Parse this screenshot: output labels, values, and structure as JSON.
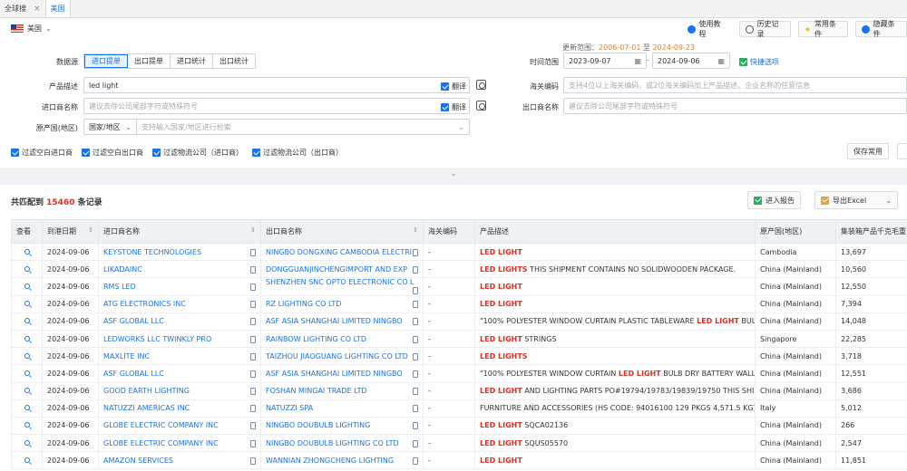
{
  "tabs": [
    {
      "label": "全球搜",
      "active": false
    },
    {
      "label": "美国",
      "active": true
    }
  ],
  "country": {
    "name": "美国"
  },
  "update_range": {
    "prefix": "更新范围：",
    "start": "2006-07-01",
    "to": "至",
    "end": "2024-09-23"
  },
  "top_buttons": {
    "tutorial": "使用教程",
    "history": "历史记录",
    "common": "常用条件",
    "hide": "隐藏条件"
  },
  "form": {
    "source_label": "数据源",
    "source_options": [
      "进口提单",
      "出口提单",
      "进口统计",
      "出口统计"
    ],
    "date_label": "时间范围",
    "date_start": "2023-09-07",
    "date_sep": "–",
    "date_end": "2024-09-06",
    "quick_label": "快捷选项",
    "product_label": "产品描述",
    "product_value": "led light",
    "translate_label": "翻译",
    "hs_label": "海关编码",
    "hs_placeholder": "支持4位以上海关编码，或2位海关编码加上产品描述、企业名称的任意信息",
    "importer_label": "进口商名称",
    "importer_placeholder": "建议去除公司尾部字符或特殊符号",
    "exporter_label": "出口商名称",
    "exporter_placeholder": "建议去除公司尾部字符或特殊符号",
    "origin_label": "原产国(地区)",
    "origin_select": "国家/地区",
    "origin_placeholder": "支持输入国家/地区进行检索",
    "filters": [
      "过滤空白进口商",
      "过滤空白出口商",
      "过滤物流公司（进口商）",
      "过滤物流公司（出口商）"
    ],
    "save_common": "保存常用"
  },
  "results": {
    "prefix": "共匹配到",
    "count": "15460",
    "suffix": "条记录",
    "report_btn": "进入报告",
    "export_btn": "导出Excel"
  },
  "table": {
    "headers": [
      "查看",
      "到港日期",
      "进口商名称",
      "出口商名称",
      "海关编码",
      "产品描述",
      "原产国(地区)",
      "集装箱产品千克毛重"
    ],
    "rows": [
      {
        "date": "2024-09-06",
        "importer": "KEYSTONE TECHNOLOGIES",
        "exporter": "NINGBO DONGXING CAMBODIA ELECTRI",
        "hs": "-",
        "hl": "LED LIGHT",
        "rest": "",
        "origin": "Cambodia",
        "weight": "13,697"
      },
      {
        "date": "2024-09-06",
        "importer": "LIKADAINC",
        "exporter": "DONGGUANJINCHENGIMPORT AND EXP",
        "hs": "-",
        "hl": "LED LIGHTS",
        "rest": " THIS SHIPMENT CONTAINS NO SOLIDWOODEN PACKAGE.",
        "origin": "China (Mainland)",
        "weight": "10,560"
      },
      {
        "date": "2024-09-06",
        "importer": "RMS LED",
        "exporter": "SHENZHEN SNC OPTO ELECTRONIC CO L",
        "hs": "-",
        "hl": "LED LIGHT",
        "rest": "",
        "origin": "China (Mainland)",
        "weight": "12,550"
      },
      {
        "date": "2024-09-06",
        "importer": "ATG ELECTRONICS INC",
        "exporter": "RZ LIGHTING CO LTD",
        "hs": "-",
        "hl": "LED LIGHT",
        "rest": "",
        "origin": "China (Mainland)",
        "weight": "7,394"
      },
      {
        "date": "2024-09-06",
        "importer": "ASF GLOBAL LLC",
        "exporter": "ASF ASIA SHANGHAI LIMITED NINGBO",
        "hs": "-",
        "pre": "\"100% POLYESTER WINDOW CURTAIN PLASTIC TABLEWARE ",
        "hl": "LED LIGHT",
        "rest": " BULB D",
        "origin": "China (Mainland)",
        "weight": "14,048"
      },
      {
        "date": "2024-09-06",
        "importer": "LEDWORKS LLC TWINKLY PRO",
        "exporter": "RAINBOW LIGHTING CO LTD",
        "hs": "-",
        "hl": "LED LIGHT",
        "rest": " STRINGS",
        "origin": "Singapore",
        "weight": "22,285"
      },
      {
        "date": "2024-09-06",
        "importer": "MAXLITE INC",
        "exporter": "TAIZHOU JIAOGUANG LIGHTING CO LTD",
        "hs": "-",
        "hl": "LED LIGHTS",
        "rest": "",
        "origin": "China (Mainland)",
        "weight": "3,718"
      },
      {
        "date": "2024-09-06",
        "importer": "ASF GLOBAL LLC",
        "exporter": "ASF ASIA SHANGHAI LIMITED NINGBO",
        "hs": "-",
        "pre": "\"100% POLYESTER WINDOW CURTAIN ",
        "hl": "LED LIGHT",
        "rest": " BULB DRY BATTERY WALL AN",
        "origin": "China (Mainland)",
        "weight": "12,551"
      },
      {
        "date": "2024-09-06",
        "importer": "GOOD EARTH LIGHTING",
        "exporter": "FOSHAN MINGAI TRADE LTD",
        "hs": "-",
        "hl": "LED LIGHT",
        "rest": " AND LIGHTING PARTS PO#19794/19783/19839/19750 THIS SHIPME",
        "origin": "China (Mainland)",
        "weight": "3,686"
      },
      {
        "date": "2024-09-06",
        "importer": "NATUZZI AMERICAS INC",
        "exporter": "NATUZZI SPA",
        "hs": "-",
        "pre": "FURNITURE AND ACCESSORIES (HS CODE: 94016100 129 PKGS 4,571.5 KG); OTH",
        "hl": "",
        "rest": "",
        "origin": "Italy",
        "weight": "5,012"
      },
      {
        "date": "2024-09-06",
        "importer": "GLOBE ELECTRIC COMPANY INC",
        "exporter": "NINGBO DOUBULB LIGHTING",
        "hs": "-",
        "hl": "LED LIGHT",
        "rest": " SQCA02136",
        "origin": "China (Mainland)",
        "weight": "266"
      },
      {
        "date": "2024-09-06",
        "importer": "GLOBE ELECTRIC COMPANY INC",
        "exporter": "NINGBO DOUBULB LIGHTING CO LTD",
        "hs": "-",
        "hl": "LED LIGHT",
        "rest": " SQUS05570",
        "origin": "China (Mainland)",
        "weight": "2,547"
      },
      {
        "date": "2024-09-06",
        "importer": "AMAZON SERVICES",
        "exporter": "WANNIAN ZHONGCHENG LIGHTING",
        "hs": "-",
        "hl": "LED LIGHT",
        "rest": "",
        "origin": "China (Mainland)",
        "weight": "11,851"
      }
    ]
  },
  "colors": {
    "accent": "#1a73e8",
    "highlight": "#d93025",
    "count": "#d93025",
    "date_accent": "#e67e22"
  }
}
